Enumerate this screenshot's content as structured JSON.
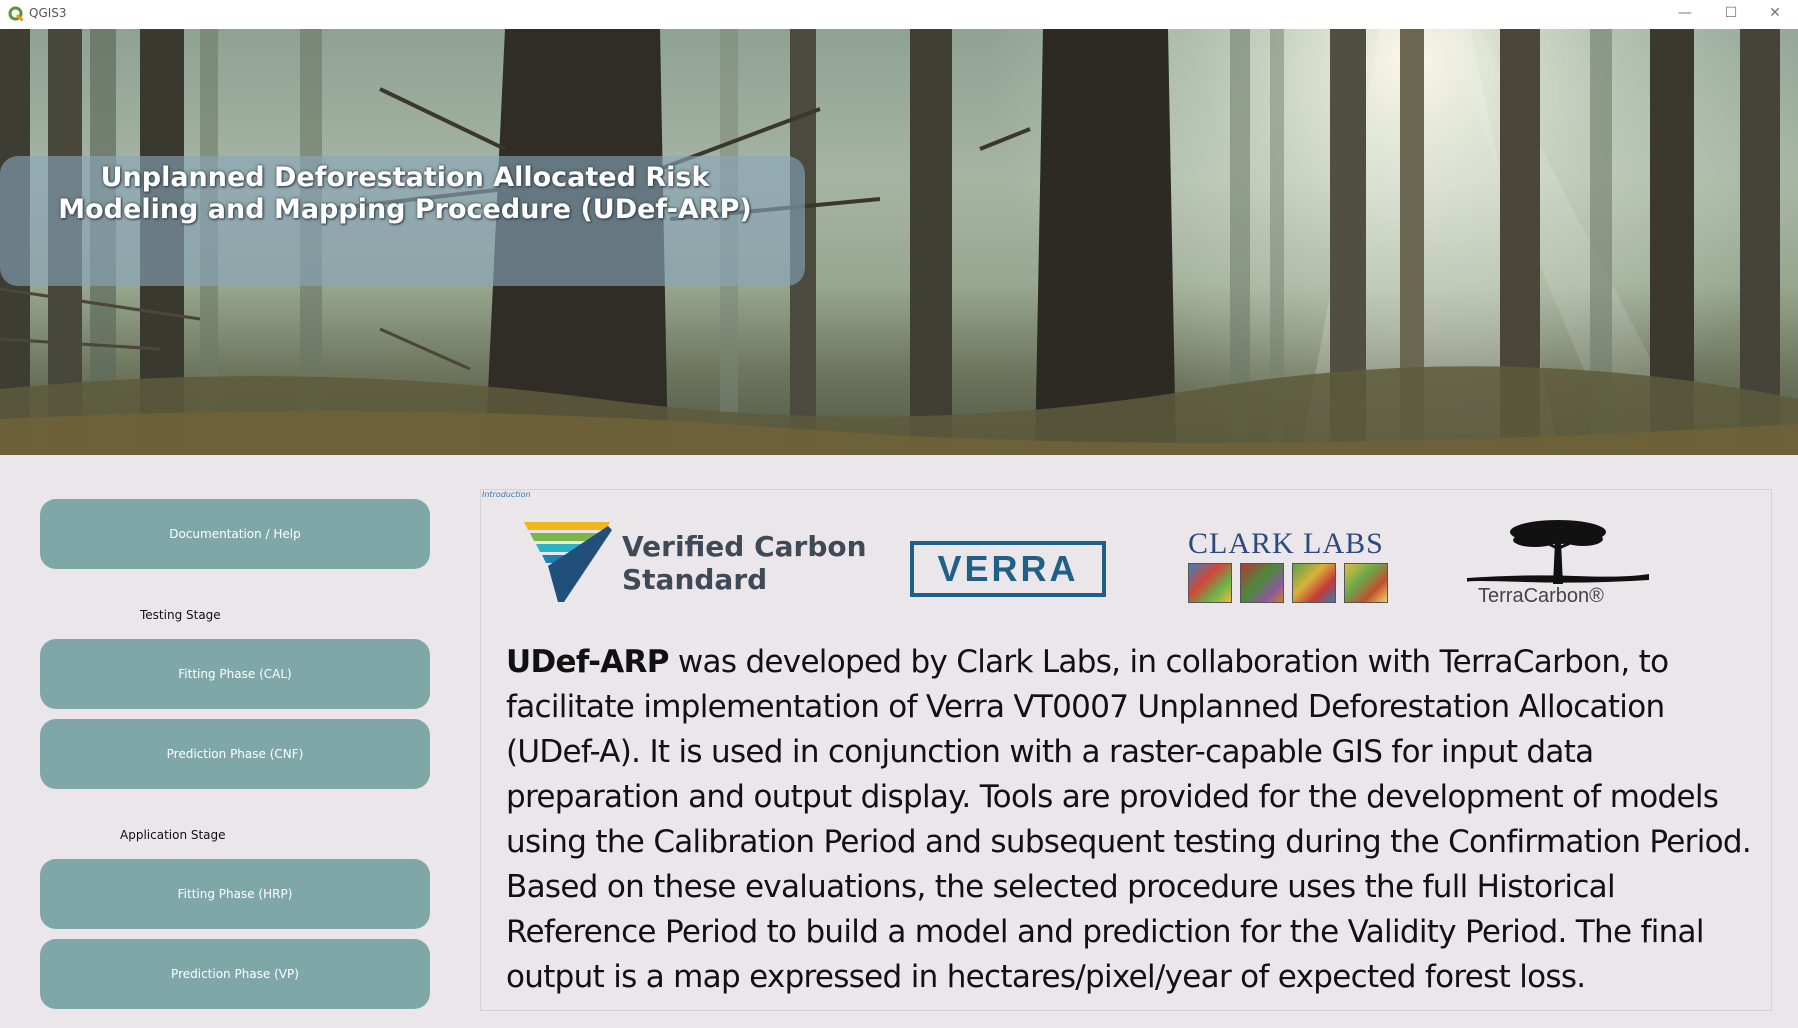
{
  "window": {
    "title": "QGIS3",
    "controls": {
      "minimize": "—",
      "maximize": "☐",
      "close": "✕"
    }
  },
  "banner": {
    "title": "Unplanned Deforestation Allocated Risk\nModeling and Mapping Procedure (UDef-ARP)"
  },
  "sidebar": {
    "doc_button": "Documentation / Help",
    "testing_label": "Testing Stage",
    "testing_buttons": [
      "Fitting Phase (CAL)",
      "Prediction Phase (CNF)"
    ],
    "application_label": "Application Stage",
    "application_buttons": [
      "Fitting Phase (HRP)",
      "Prediction Phase (VP)"
    ]
  },
  "intro": {
    "label": "Introduction",
    "logos": {
      "vcs": "Verified Carbon\nStandard",
      "verra": "VERRA",
      "clark": "CLARK LABS",
      "terra": "TerraCarbon®"
    },
    "lead": "UDef-ARP",
    "body": " was developed by Clark Labs, in collaboration with TerraCarbon, to facilitate implementation of Verra VT0007 Unplanned Deforestation Allocation (UDef-A). It is used in conjunction with a raster-capable GIS for input data preparation and output display. Tools are provided for the development of models using the Calibration Period and subsequent testing during the Confirmation Period. Based on these evaluations, the selected procedure uses the full Historical Reference Period to build a model and prediction for the Validity Period. The final output is a map expressed in hectares/pixel/year of expected forest loss."
  }
}
